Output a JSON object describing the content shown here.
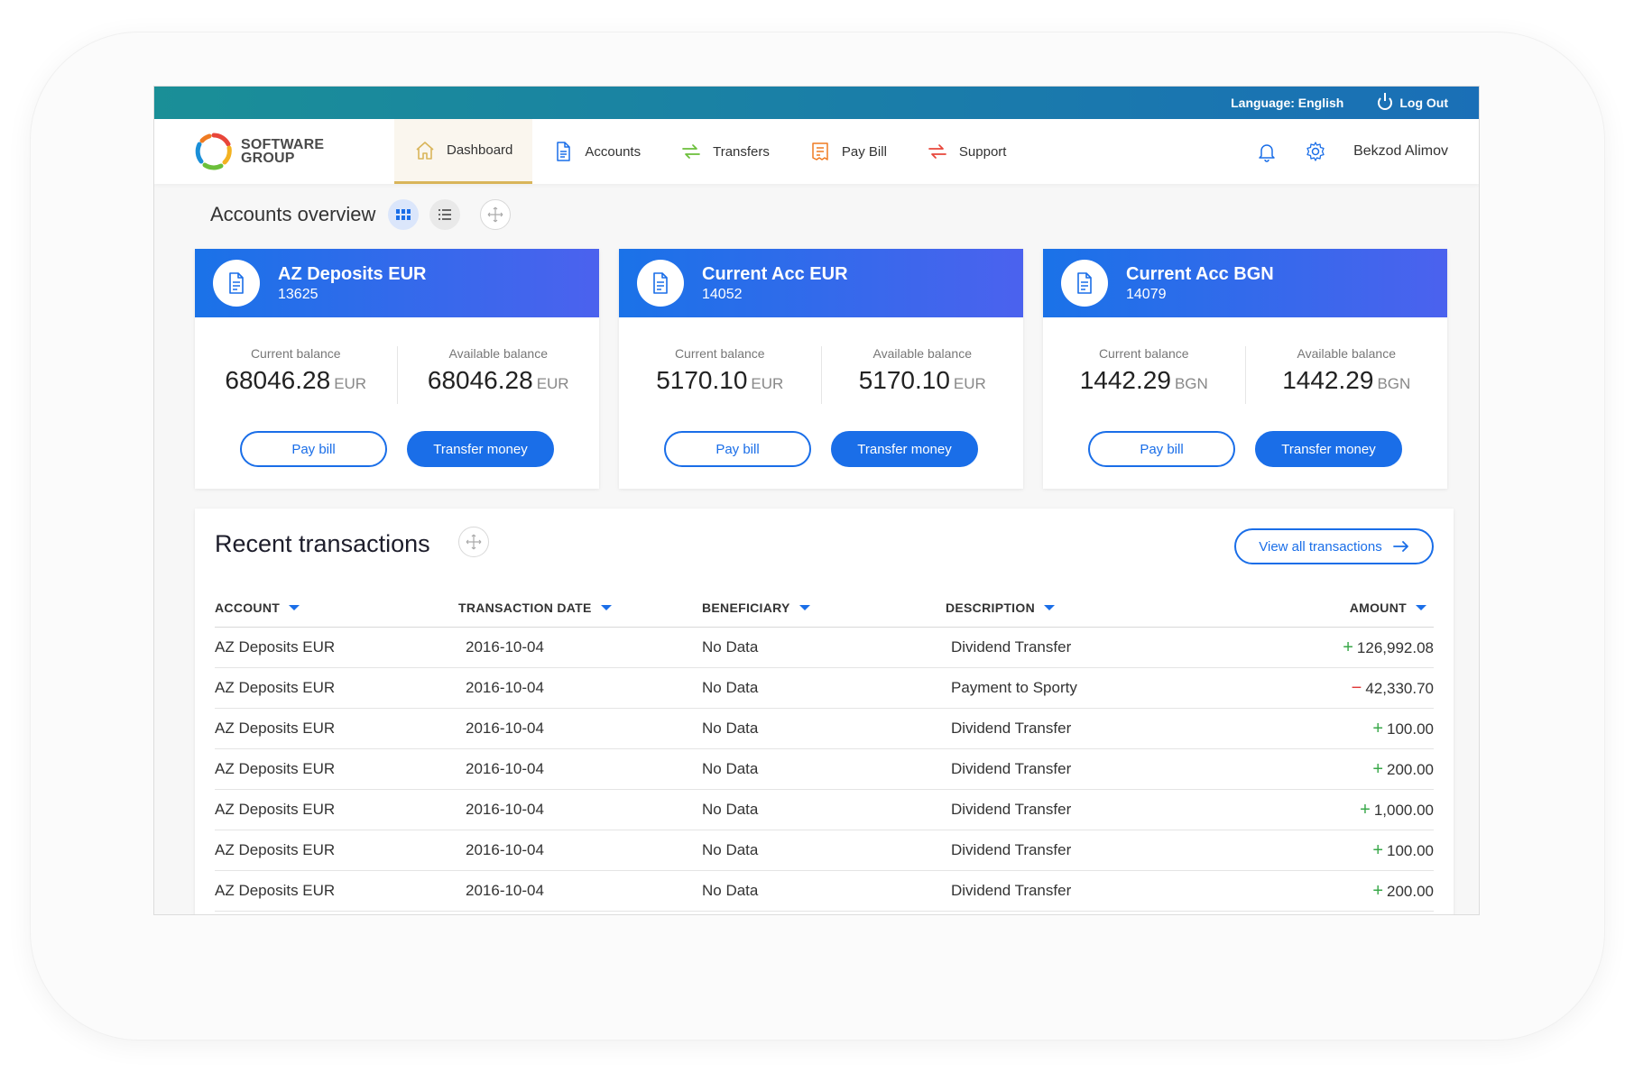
{
  "topbar": {
    "language": "Language: English",
    "logout": "Log Out"
  },
  "brand": {
    "line1": "SOFTWARE",
    "line2": "GROUP"
  },
  "nav": {
    "items": [
      {
        "label": "Dashboard",
        "icon": "home-icon",
        "active": true
      },
      {
        "label": "Accounts",
        "icon": "document-icon"
      },
      {
        "label": "Transfers",
        "icon": "transfer-icon"
      },
      {
        "label": "Pay Bill",
        "icon": "bill-icon"
      },
      {
        "label": "Support",
        "icon": "support-icon"
      }
    ],
    "user": "Bekzod Alimov"
  },
  "overview": {
    "title": "Accounts overview"
  },
  "accounts": [
    {
      "name": "AZ Deposits EUR",
      "number": "13625",
      "current_label": "Current balance",
      "current": "68046.28",
      "available_label": "Available balance",
      "available": "68046.28",
      "currency": "EUR",
      "pay": "Pay bill",
      "transfer": "Transfer money"
    },
    {
      "name": "Current Acc EUR",
      "number": "14052",
      "current_label": "Current balance",
      "current": "5170.10",
      "available_label": "Available balance",
      "available": "5170.10",
      "currency": "EUR",
      "pay": "Pay bill",
      "transfer": "Transfer money"
    },
    {
      "name": "Current Acc BGN",
      "number": "14079",
      "current_label": "Current balance",
      "current": "1442.29",
      "available_label": "Available balance",
      "available": "1442.29",
      "currency": "BGN",
      "pay": "Pay bill",
      "transfer": "Transfer money"
    }
  ],
  "transactions": {
    "title": "Recent transactions",
    "view_all": "View all transactions",
    "columns": [
      "ACCOUNT",
      "TRANSACTION DATE",
      "BENEFICIARY",
      "DESCRIPTION",
      "AMOUNT"
    ],
    "rows": [
      {
        "account": "AZ Deposits EUR",
        "date": "2016-10-04",
        "beneficiary": "No Data",
        "description": "Dividend Transfer",
        "sign": "+",
        "amount": "126,992.08"
      },
      {
        "account": "AZ Deposits EUR",
        "date": "2016-10-04",
        "beneficiary": "No Data",
        "description": "Payment to Sporty",
        "sign": "−",
        "amount": "42,330.70"
      },
      {
        "account": "AZ Deposits EUR",
        "date": "2016-10-04",
        "beneficiary": "No Data",
        "description": "Dividend Transfer",
        "sign": "+",
        "amount": "100.00"
      },
      {
        "account": "AZ Deposits EUR",
        "date": "2016-10-04",
        "beneficiary": "No Data",
        "description": "Dividend Transfer",
        "sign": "+",
        "amount": "200.00"
      },
      {
        "account": "AZ Deposits EUR",
        "date": "2016-10-04",
        "beneficiary": "No Data",
        "description": "Dividend Transfer",
        "sign": "+",
        "amount": "1,000.00"
      },
      {
        "account": "AZ Deposits EUR",
        "date": "2016-10-04",
        "beneficiary": "No Data",
        "description": "Dividend Transfer",
        "sign": "+",
        "amount": "100.00"
      },
      {
        "account": "AZ Deposits EUR",
        "date": "2016-10-04",
        "beneficiary": "No Data",
        "description": "Dividend Transfer",
        "sign": "+",
        "amount": "200.00"
      }
    ]
  },
  "colors": {
    "accent": "#1a6ee8",
    "positive": "#3aa84a",
    "negative": "#e03a3a",
    "active_tab": "#d9b55a"
  }
}
